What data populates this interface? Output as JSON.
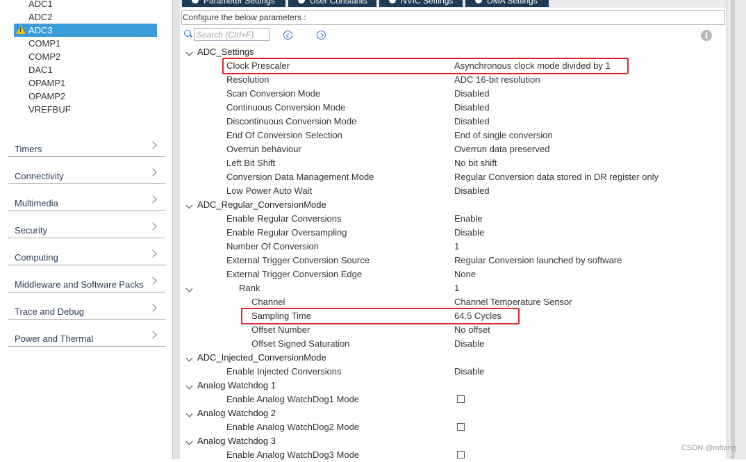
{
  "sidebar": {
    "peripherals": [
      {
        "label": "ADC1",
        "selected": false,
        "warning": false
      },
      {
        "label": "ADC2",
        "selected": false,
        "warning": false
      },
      {
        "label": "ADC3",
        "selected": true,
        "warning": true
      },
      {
        "label": "COMP1",
        "selected": false,
        "warning": false
      },
      {
        "label": "COMP2",
        "selected": false,
        "warning": false
      },
      {
        "label": "DAC1",
        "selected": false,
        "warning": false
      },
      {
        "label": "OPAMP1",
        "selected": false,
        "warning": false
      },
      {
        "label": "OPAMP2",
        "selected": false,
        "warning": false
      },
      {
        "label": "VREFBUF",
        "selected": false,
        "warning": false
      }
    ],
    "categories": [
      "Timers",
      "Connectivity",
      "Multimedia",
      "Security",
      "Computing",
      "Middleware and Software Packs",
      "Trace and Debug",
      "Power and Thermal"
    ]
  },
  "tabs": [
    "Parameter Settings",
    "User Constants",
    "NVIC Settings",
    "DMA Settings"
  ],
  "config": {
    "header": "Configure the below parameters :",
    "search_placeholder": "Search (Ctrl+F)"
  },
  "tree": [
    {
      "kind": "group",
      "level": 0,
      "label": "ADC_Settings"
    },
    {
      "kind": "param",
      "level": 1,
      "label": "Clock Prescaler",
      "value": "Asynchronous clock mode divided by 1",
      "highlight": true
    },
    {
      "kind": "param",
      "level": 1,
      "label": "Resolution",
      "value": "ADC 16-bit resolution"
    },
    {
      "kind": "param",
      "level": 1,
      "label": "Scan Conversion Mode",
      "value": "Disabled"
    },
    {
      "kind": "param",
      "level": 1,
      "label": "Continuous Conversion Mode",
      "value": "Disabled"
    },
    {
      "kind": "param",
      "level": 1,
      "label": "Discontinuous Conversion Mode",
      "value": "Disabled"
    },
    {
      "kind": "param",
      "level": 1,
      "label": "End Of Conversion Selection",
      "value": "End of single conversion"
    },
    {
      "kind": "param",
      "level": 1,
      "label": "Overrun behaviour",
      "value": "Overrun data preserved"
    },
    {
      "kind": "param",
      "level": 1,
      "label": "Left Bit Shift",
      "value": "No bit shift"
    },
    {
      "kind": "param",
      "level": 1,
      "label": "Conversion Data Management Mode",
      "value": "Regular Conversion data stored in DR register only"
    },
    {
      "kind": "param",
      "level": 1,
      "label": "Low Power Auto Wait",
      "value": "Disabled"
    },
    {
      "kind": "group",
      "level": 0,
      "label": "ADC_Regular_ConversionMode"
    },
    {
      "kind": "param",
      "level": 1,
      "label": "Enable Regular Conversions",
      "value": "Enable"
    },
    {
      "kind": "param",
      "level": 1,
      "label": "Enable Regular Oversampling",
      "value": "Disable"
    },
    {
      "kind": "param",
      "level": 1,
      "label": "Number Of Conversion",
      "value": "1"
    },
    {
      "kind": "param",
      "level": 1,
      "label": "External Trigger Conversion Source",
      "value": "Regular Conversion launched by software"
    },
    {
      "kind": "param",
      "level": 1,
      "label": "External Trigger Conversion Edge",
      "value": "None"
    },
    {
      "kind": "subgroup",
      "level": 1,
      "label": "Rank",
      "value": "1"
    },
    {
      "kind": "param",
      "level": 2,
      "label": "Channel",
      "value": "Channel Temperature Sensor"
    },
    {
      "kind": "param",
      "level": 2,
      "label": "Sampling Time",
      "value": "64.5 Cycles",
      "highlight": true
    },
    {
      "kind": "param",
      "level": 2,
      "label": "Offset Number",
      "value": "No offset"
    },
    {
      "kind": "param",
      "level": 2,
      "label": "Offset Signed Saturation",
      "value": "Disable"
    },
    {
      "kind": "group",
      "level": 0,
      "label": "ADC_Injected_ConversionMode"
    },
    {
      "kind": "param",
      "level": 1,
      "label": "Enable Injected Conversions",
      "value": "Disable"
    },
    {
      "kind": "group",
      "level": 0,
      "label": "Analog Watchdog 1"
    },
    {
      "kind": "check",
      "level": 1,
      "label": "Enable Analog WatchDog1 Mode",
      "checked": false
    },
    {
      "kind": "group",
      "level": 0,
      "label": "Analog Watchdog 2"
    },
    {
      "kind": "check",
      "level": 1,
      "label": "Enable Analog WatchDog2 Mode",
      "checked": false
    },
    {
      "kind": "group",
      "level": 0,
      "label": "Analog Watchdog 3"
    },
    {
      "kind": "check",
      "level": 1,
      "label": "Enable Analog WatchDog3 Mode",
      "checked": false
    }
  ],
  "watermark": "CSDN @mftang",
  "colors": {
    "selection": "#3a9bd9",
    "tab": "#1f3a56",
    "highlight_box": "#e0252b",
    "link_icon": "#2c78c8"
  }
}
